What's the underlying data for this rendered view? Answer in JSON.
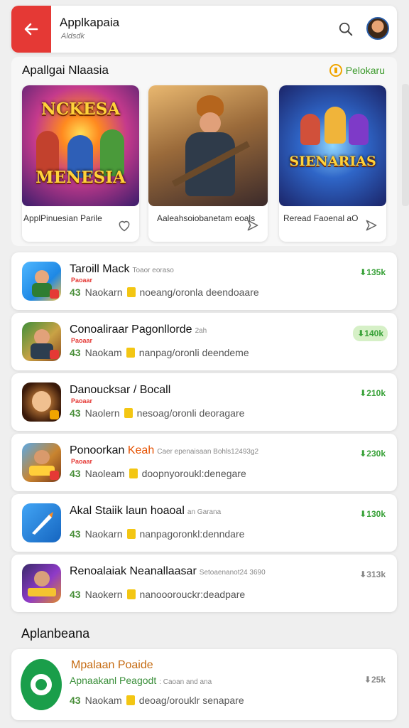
{
  "header": {
    "title": "Applkapaia",
    "subtitle": "Aldsdk"
  },
  "featured": {
    "title": "Apallgai Nlaasia",
    "see_more": "Pelokaru",
    "cards": [
      {
        "art_text": "NCKESA",
        "art_text2": "MENESIA",
        "name": "ApplPinuesian Parile"
      },
      {
        "name": "Aaleahsoiobanetam eoals"
      },
      {
        "art_text": "SIENARIAS",
        "name": "Reread Faoenal aO"
      }
    ]
  },
  "list": [
    {
      "title": "Taroill Mack",
      "tag": "Toaor eoraso",
      "publisher": "Paoaar",
      "rating": "43",
      "meta_a": "Naokarn",
      "meta_b": "noeang/oronla deendoaare",
      "downloads": "135k"
    },
    {
      "title": "Conoaliraar Pagonllorde",
      "tag": "2ah",
      "publisher": "Paoaar",
      "rating": "43",
      "meta_a": "Naokam",
      "meta_b": "nanpag/oronli deendeme",
      "downloads": "140k"
    },
    {
      "title": "Danoucksar / Bocall",
      "tag": "",
      "publisher": "Paoaar",
      "rating": "43",
      "meta_a": "Naolern",
      "meta_b": "nesoag/oronli deoragare",
      "downloads": "210k"
    },
    {
      "title": "Ponoorkan",
      "title_accent": "Keah",
      "tag": "Caer epenaisaan Bohls12493g2",
      "publisher": "Paoaar",
      "rating": "43",
      "meta_a": "Naoleam",
      "meta_b": "doopnyoroukl:denegare",
      "downloads": "230k"
    },
    {
      "title": "Akal Staiik laun hoaoal",
      "tag": "an Garana",
      "publisher": "",
      "rating": "43",
      "meta_a": "Naokarn",
      "meta_b": "nanpagoronkl:denndare",
      "downloads": "130k"
    },
    {
      "title": "Renoalaiak Neanallaasar",
      "tag": "Setoaenanot24 3690",
      "publisher": "",
      "rating": "43",
      "meta_a": "Naokern",
      "meta_b": "nanooorouckr:deadpare",
      "downloads": "313k"
    }
  ],
  "section2": {
    "title": "Aplanbeana"
  },
  "bottom_item": {
    "title": "Mpalaan Poaide",
    "subtitle": "Apnaakanl Peagodt",
    "tag": ": Caoan and ana",
    "rating": "43",
    "meta_a": "Naokam",
    "meta_b": "deoag/orouklr senapare",
    "downloads": "25k"
  },
  "colors": {
    "accent": "#e53935",
    "green": "#3aa23a",
    "background": "#efefef"
  }
}
